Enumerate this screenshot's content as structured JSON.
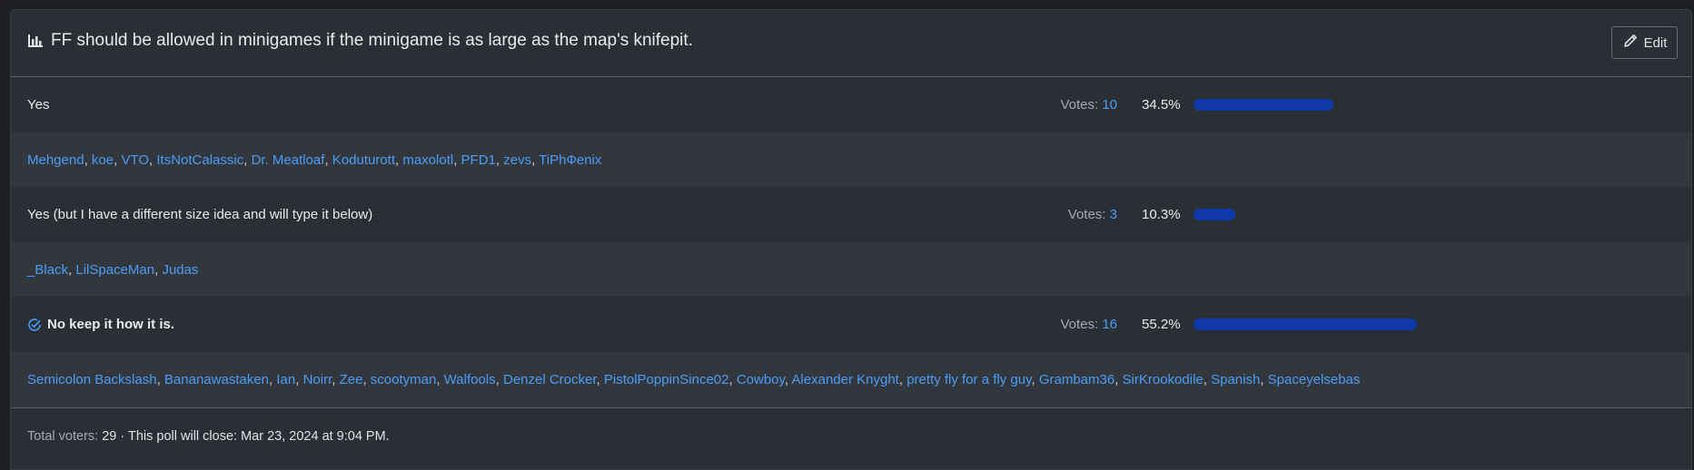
{
  "poll": {
    "title": "FF should be allowed in minigames if the minigame is as large as the map's knifepit.",
    "edit_label": "Edit",
    "votes_prefix": "Votes:",
    "options": [
      {
        "label": "Yes",
        "votes": "10",
        "percent": "34.5%",
        "fraction": 0.345,
        "selected": false,
        "voters": [
          "Mehgend",
          "koe",
          "VTO",
          "ItsNotCalassic",
          "Dr. Meatloaf",
          "Koduturott",
          "maxolotl",
          "PFD1",
          "zevs",
          "TiPhФenix"
        ]
      },
      {
        "label": "Yes (but I have a different size idea and will type it below)",
        "votes": "3",
        "percent": "10.3%",
        "fraction": 0.103,
        "selected": false,
        "voters": [
          "_Black",
          "LilSpaceMan",
          "Judas"
        ]
      },
      {
        "label": "No keep it how it is.",
        "votes": "16",
        "percent": "55.2%",
        "fraction": 0.552,
        "selected": true,
        "voters": [
          "Semicolon Backslash",
          "Bananawastaken",
          "Ian",
          "Noirr",
          "Zee",
          "scootyman",
          "Walfools",
          "Denzel Crocker",
          "PistolPoppinSince02",
          "Cowboy",
          "Alexander Knyght",
          "pretty fly for a fly guy",
          "Grambam36",
          "SirKrookodile",
          "Spanish",
          "Spaceyelsebas"
        ]
      }
    ],
    "footer": {
      "total_label": "Total voters:",
      "total_value": "29",
      "separator": "·",
      "close_text": "This poll will close: Mar 23, 2024 at 9:04 PM."
    },
    "colors": {
      "link": "#4c9cf5",
      "bar": "#0f39a8"
    },
    "icons": {
      "title_icon": "bar-chart-icon",
      "edit_icon": "pencil-icon",
      "selected_icon": "check-circle-icon"
    }
  }
}
